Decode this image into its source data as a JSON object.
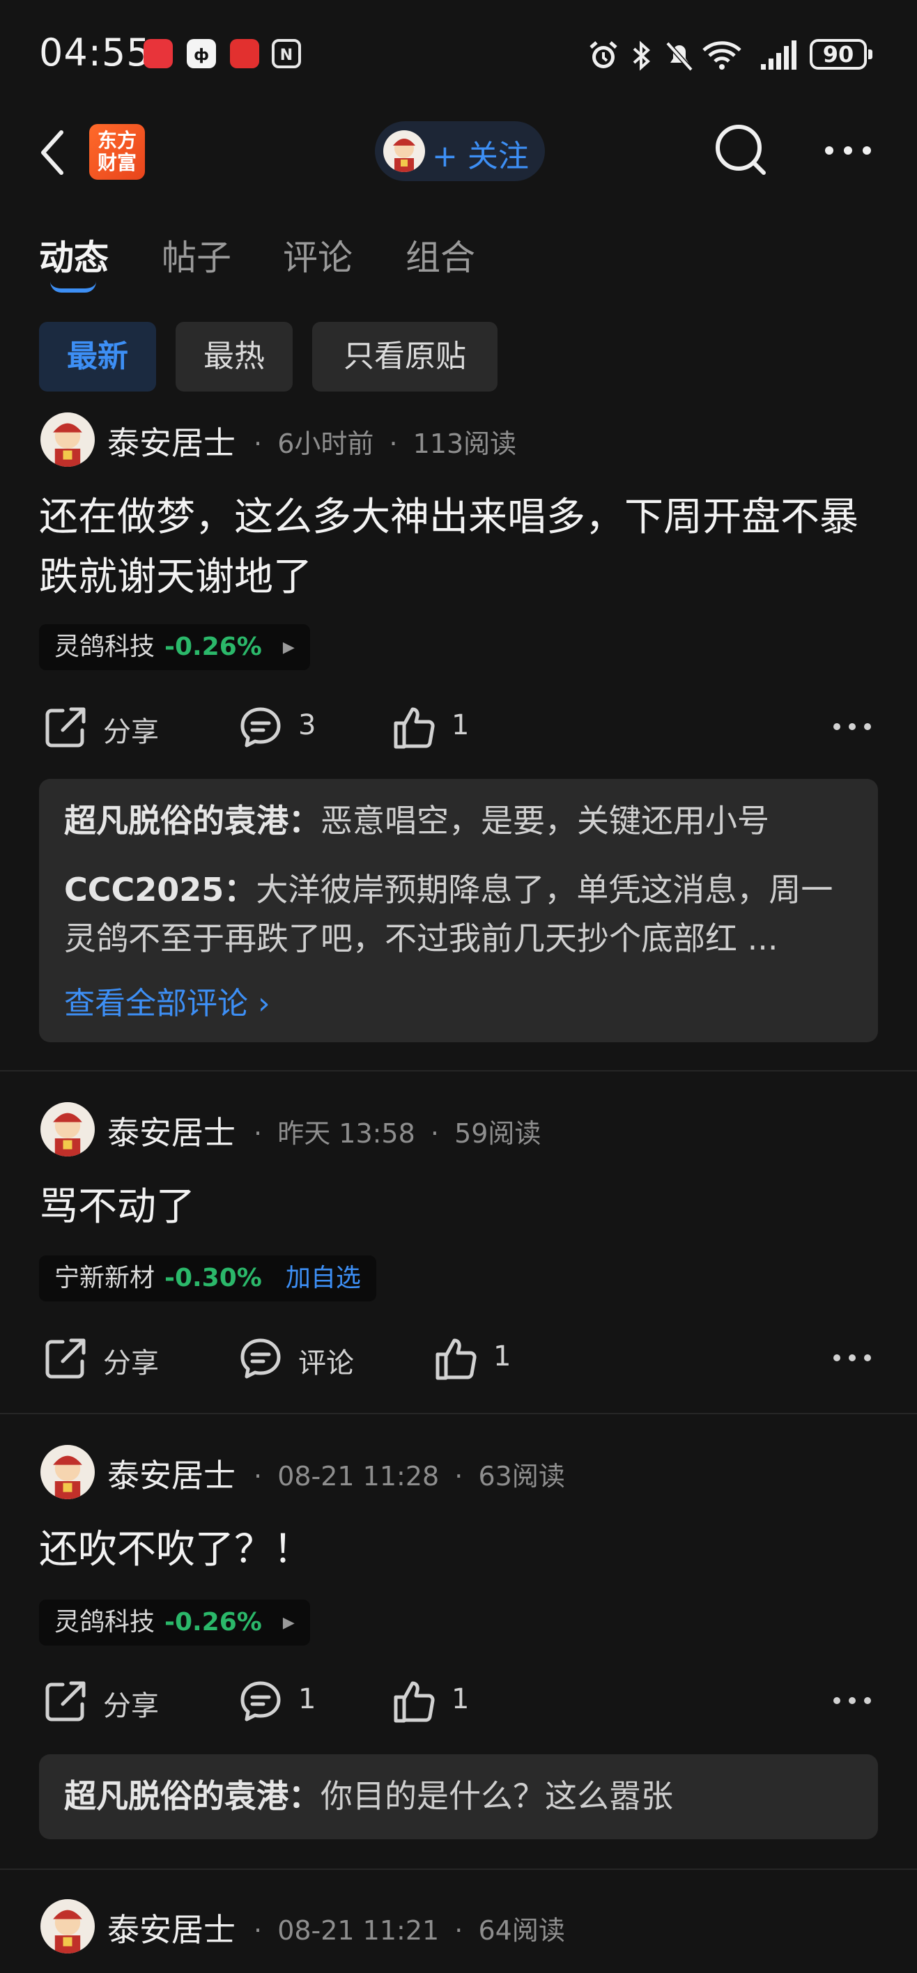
{
  "status": {
    "time": "04:55",
    "battery": "90",
    "app_icons": [
      "huawei-store-icon",
      "dongfang-icon",
      "news-icon",
      "nfc-icon"
    ]
  },
  "nav": {
    "logo_line1": "东方",
    "logo_line2": "财富",
    "follow_label": "+ 关注"
  },
  "tabs": [
    {
      "label": "动态",
      "active": true
    },
    {
      "label": "帖子",
      "active": false
    },
    {
      "label": "评论",
      "active": false
    },
    {
      "label": "组合",
      "active": false
    }
  ],
  "filters": [
    {
      "label": "最新",
      "active": true
    },
    {
      "label": "最热",
      "active": false
    },
    {
      "label": "只看原贴",
      "active": false
    }
  ],
  "posts": [
    {
      "author": "泰安居士",
      "time": "6小时前",
      "reads": "113阅读",
      "text": "还在做梦，这么多大神出来唱多，下周开盘不暴跌就谢天谢地了",
      "stock": {
        "name": "灵鸽科技",
        "change": "-0.26%",
        "extra": "▶"
      },
      "actions": {
        "share": "分享",
        "comments": "3",
        "likes": "1"
      },
      "comments": [
        {
          "user": "超凡脱俗的袁港：",
          "text": "恶意唱空，是要，关键还用小号"
        },
        {
          "user": "CCC2025：",
          "text": "大洋彼岸预期降息了，单凭这消息，周一灵鸽不至于再跌了吧，不过我前几天抄个底部红 ..."
        }
      ],
      "view_all": "查看全部评论 ›"
    },
    {
      "author": "泰安居士",
      "time": "昨天 13:58",
      "reads": "59阅读",
      "text": "骂不动了",
      "stock": {
        "name": "宁新新材",
        "change": "-0.30%",
        "extra": "加自选"
      },
      "actions": {
        "share": "分享",
        "comments": "评论",
        "likes": "1"
      }
    },
    {
      "author": "泰安居士",
      "time": "08-21 11:28",
      "reads": "63阅读",
      "text": "还吹不吹了？！",
      "stock": {
        "name": "灵鸽科技",
        "change": "-0.26%",
        "extra": "▶"
      },
      "actions": {
        "share": "分享",
        "comments": "1",
        "likes": "1"
      },
      "comments": [
        {
          "user": "超凡脱俗的袁港：",
          "text": "你目的是什么？这么嚣张"
        }
      ]
    },
    {
      "author": "泰安居士",
      "time": "08-21 11:21",
      "reads": "64阅读"
    }
  ],
  "meta_separator": "·",
  "colors": {
    "background": "#141414",
    "accent_blue": "#3d8ff5",
    "down_green": "#2bb86a",
    "logo_orange": "#ff6a2a"
  }
}
